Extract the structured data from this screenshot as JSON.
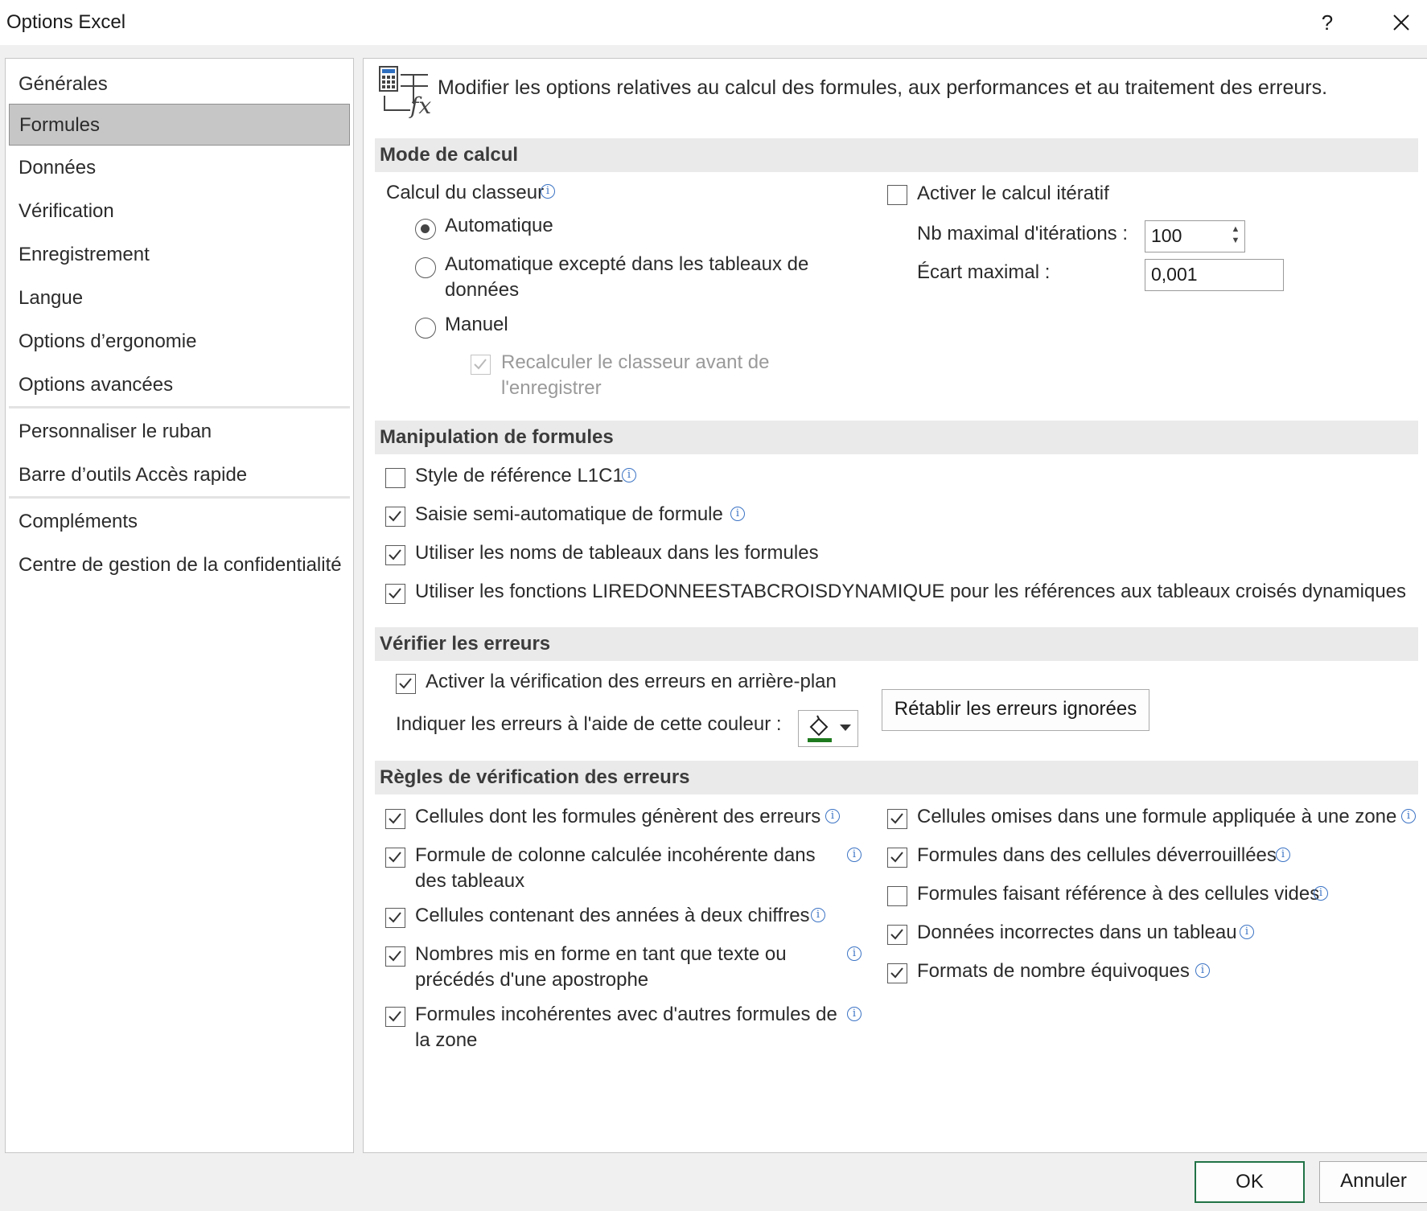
{
  "window": {
    "title": "Options Excel",
    "help_label": "?"
  },
  "sidebar": {
    "items": [
      {
        "label": "Générales"
      },
      {
        "label": "Formules"
      },
      {
        "label": "Données"
      },
      {
        "label": "Vérification"
      },
      {
        "label": "Enregistrement"
      },
      {
        "label": "Langue"
      },
      {
        "label": "Options d’ergonomie"
      },
      {
        "label": "Options avancées"
      },
      {
        "label": "Personnaliser le ruban"
      },
      {
        "label": "Barre d’outils Accès rapide"
      },
      {
        "label": "Compléments"
      },
      {
        "label": "Centre de gestion de la confidentialité"
      }
    ],
    "selected": "Formules"
  },
  "content": {
    "header_icon": "formula-calculator-icon",
    "header_text": "Modifier les options relatives au calcul des formules, aux performances et au traitement des erreurs.",
    "calc": {
      "title": "Mode de calcul",
      "workbook_label": "Calcul du classeur",
      "radio_auto": "Automatique",
      "radio_auto_except_1": "Automatique excepté dans les tableaux de",
      "radio_auto_except_2": "données",
      "radio_manual": "Manuel",
      "recalc_1": "Recalculer le classeur avant de",
      "recalc_2": "l'enregistrer",
      "iterative_label": "Activer le calcul itératif",
      "max_iter_label": "Nb maximal d'itérations :",
      "max_iter_value": "100",
      "max_change_label": "Écart maximal :",
      "max_change_value": "0,001"
    },
    "formulas": {
      "title": "Manipulation de formules",
      "r1c1": "Style de référence L1C1",
      "autocomplete": "Saisie semi-automatique de formule",
      "table_names": "Utiliser les noms de tableaux dans les formules",
      "getpivot": "Utiliser les fonctions LIREDONNEESTABCROISDYNAMIQUE pour les références aux tableaux croisés dynamiques"
    },
    "errors": {
      "title": "Vérifier les erreurs",
      "background": "Activer la vérification des erreurs en arrière-plan",
      "color_label": "Indiquer les erreurs à l'aide de cette couleur :",
      "color_value": "#1e7a1e",
      "reset_button": "Rétablir les erreurs ignorées"
    },
    "rules": {
      "title": "Règles de vérification des erreurs",
      "left_1": "Cellules dont les formules génèrent des erreurs",
      "left_2a": "Formule de colonne calculée incohérente dans",
      "left_2b": "des tableaux",
      "left_3": "Cellules contenant des années à deux chiffres",
      "left_4a": "Nombres mis en forme en tant que texte ou",
      "left_4b": "précédés d'une apostrophe",
      "left_5a": "Formules incohérentes avec d'autres formules de",
      "left_5b": "la zone",
      "right_1": "Cellules omises dans une formule appliquée à une zone",
      "right_2": "Formules dans des cellules déverrouillées",
      "right_3": "Formules faisant référence à des cellules vides",
      "right_4": "Données incorrectes dans un tableau",
      "right_5": "Formats de nombre équivoques"
    }
  },
  "footer": {
    "ok_label": "OK",
    "cancel_label": "Annuler"
  }
}
